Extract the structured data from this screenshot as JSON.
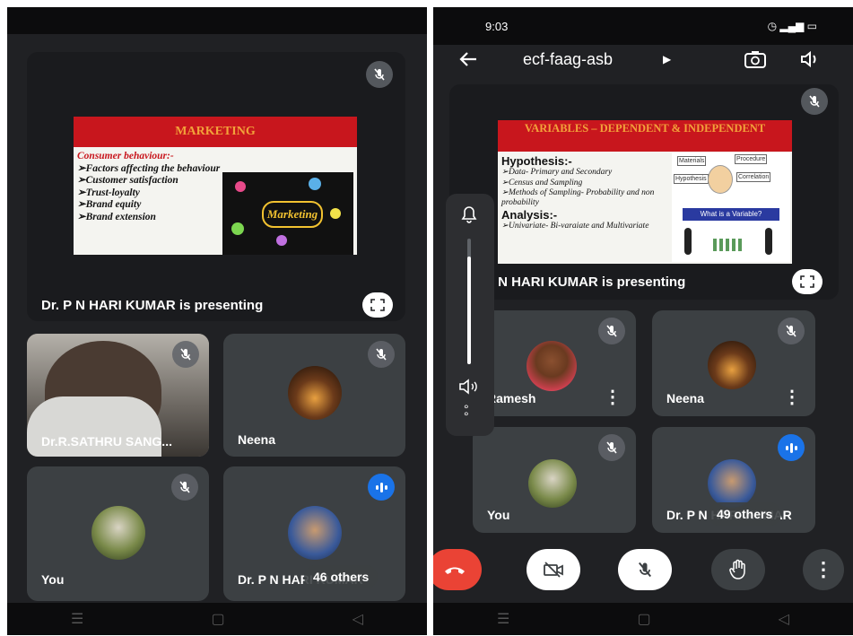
{
  "left": {
    "presentation": {
      "slide_title": "MARKETING",
      "slide_lines": [
        "Consumer behaviour:-",
        "➢Factors affecting the behaviour",
        "➢Customer satisfaction",
        "➢Trust-loyalty",
        "➢Brand equity",
        "➢Brand extension"
      ],
      "slide_graphic_text": "Marketing",
      "presenting_label": "Dr. P N HARI KUMAR is presenting"
    },
    "participants": [
      {
        "name": "Dr.R.SATHRU SANG..."
      },
      {
        "name": "Neena"
      },
      {
        "name": "You"
      },
      {
        "name": "Dr. P N HARI KUMAR"
      }
    ],
    "others_badge": "46 others"
  },
  "right": {
    "status": {
      "time": "9:03"
    },
    "header": {
      "meeting_code": "ecf-faag-asb"
    },
    "presentation": {
      "slide_title": "VARIABLES – DEPENDENT & INDEPENDENT",
      "hypothesis_heading": "Hypothesis:-",
      "hypothesis_lines": [
        "➢Data- Primary and Secondary",
        "➢Census and Sampling",
        "➢Methods of Sampling- Probability and non probability"
      ],
      "analysis_heading": "Analysis:-",
      "analysis_lines": [
        "➢Univariate- Bi-varaiate and Multivariate"
      ],
      "graphic_caption": "What is a Variable?",
      "graphic_labels": [
        "Materials",
        "Procedure",
        "Hypothesis",
        "Correlation"
      ],
      "presenting_label": "Dr. P N HARI KUMAR is presenting"
    },
    "participants": [
      {
        "name": "Ramesh"
      },
      {
        "name": "Neena"
      },
      {
        "name": "You"
      },
      {
        "name": "Dr. P N HARI KUMAR"
      }
    ],
    "others_badge": "49 others"
  },
  "icons": {
    "mic_off": "mic-off-icon",
    "fullscreen": "fullscreen-icon",
    "back": "arrow-back-icon",
    "camera_switch": "camera-switch-icon",
    "volume": "volume-icon",
    "bell": "bell-icon",
    "more": "more-vert-icon",
    "end_call": "end-call-icon",
    "camera_off": "camera-off-icon",
    "raise_hand": "hand-icon"
  },
  "colors": {
    "bg": "#202124",
    "tile": "#3c4043",
    "end_call": "#ea4335",
    "speaking": "#1a73e8",
    "slide_red": "#c8161d"
  }
}
